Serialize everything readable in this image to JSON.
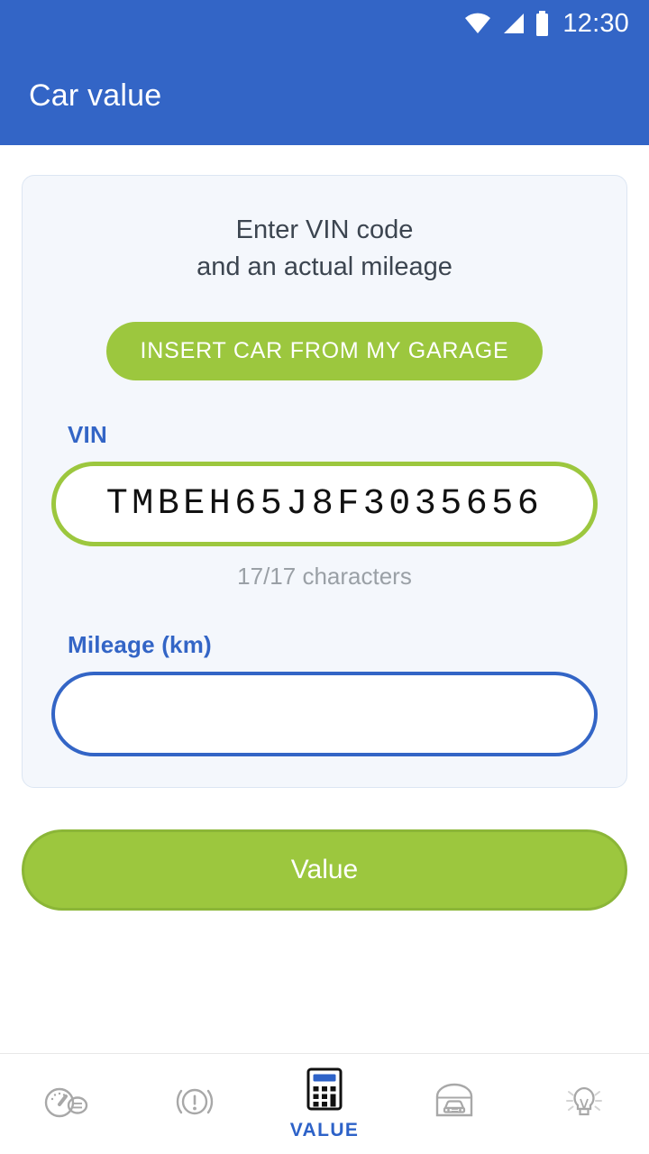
{
  "statusbar": {
    "time": "12:30",
    "icons": [
      "wifi-icon",
      "cell-signal-icon",
      "battery-icon"
    ]
  },
  "appbar": {
    "title": "Car value"
  },
  "card": {
    "heading_line1": "Enter VIN code",
    "heading_line2": "and an actual mileage",
    "garage_button_label": "INSERT CAR FROM MY GARAGE",
    "vin": {
      "label": "VIN",
      "value": "TMBEH65J8F3035656",
      "placeholder": "",
      "helper": "17/17 characters",
      "border_color": "#9CC73E"
    },
    "mileage": {
      "label": "Mileage (km)",
      "value": "",
      "placeholder": "",
      "border_color": "#3365C6"
    }
  },
  "primary_action": {
    "label": "Value"
  },
  "bottomnav": {
    "items": [
      {
        "label": "",
        "icon": "speedometer-icon",
        "active": false
      },
      {
        "label": "",
        "icon": "warning-alert-icon",
        "active": false
      },
      {
        "label": "VALUE",
        "icon": "calculator-icon",
        "active": true
      },
      {
        "label": "",
        "icon": "garage-car-icon",
        "active": false
      },
      {
        "label": "",
        "icon": "lightbulb-icon",
        "active": false
      }
    ]
  },
  "colors": {
    "brand_blue": "#3365C6",
    "brand_green": "#9CC73E",
    "card_bg": "#F4F7FC",
    "active_nav": "#2D62C8",
    "inactive_nav": "#9E9E9E"
  }
}
